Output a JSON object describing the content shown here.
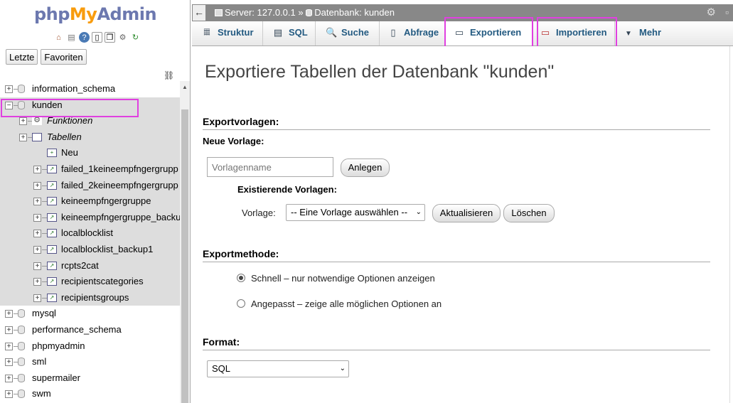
{
  "app": {
    "logo": {
      "php": "php",
      "my": "My",
      "admin": "Admin"
    },
    "nav_buttons": {
      "recent": "Letzte",
      "favorites": "Favoriten"
    },
    "tree": [
      {
        "label": "information_schema",
        "type": "db",
        "expanded": false
      },
      {
        "label": "kunden",
        "type": "db",
        "expanded": true,
        "selected": true
      },
      {
        "label": "Funktionen",
        "type": "group",
        "italic": true
      },
      {
        "label": "Tabellen",
        "type": "group",
        "italic": true
      },
      {
        "label": "Neu",
        "type": "new"
      },
      {
        "label": "failed_1keineempfngergrupp",
        "type": "table"
      },
      {
        "label": "failed_2keineempfngergrupp",
        "type": "table"
      },
      {
        "label": "keineempfngergruppe",
        "type": "table"
      },
      {
        "label": "keineempfngergruppe_backu",
        "type": "table"
      },
      {
        "label": "localblocklist",
        "type": "table"
      },
      {
        "label": "localblocklist_backup1",
        "type": "table"
      },
      {
        "label": "rcpts2cat",
        "type": "table"
      },
      {
        "label": "recipientscategories",
        "type": "table"
      },
      {
        "label": "recipientsgroups",
        "type": "table"
      },
      {
        "label": "mysql",
        "type": "db",
        "expanded": false
      },
      {
        "label": "performance_schema",
        "type": "db",
        "expanded": false
      },
      {
        "label": "phpmyadmin",
        "type": "db",
        "expanded": false
      },
      {
        "label": "sml",
        "type": "db",
        "expanded": false
      },
      {
        "label": "supermailer",
        "type": "db",
        "expanded": false
      },
      {
        "label": "swm",
        "type": "db",
        "expanded": false
      }
    ]
  },
  "header": {
    "server": "Server: 127.0.0.1",
    "separator": "»",
    "database": "Datenbank: kunden"
  },
  "tabs": [
    {
      "label": "Struktur",
      "icon": "structure-icon"
    },
    {
      "label": "SQL",
      "icon": "sql-icon"
    },
    {
      "label": "Suche",
      "icon": "search-icon"
    },
    {
      "label": "Abfrage",
      "icon": "query-icon"
    },
    {
      "label": "Exportieren",
      "icon": "export-icon",
      "active": true
    },
    {
      "label": "Importieren",
      "icon": "import-icon"
    },
    {
      "label": "Mehr",
      "icon": "caret-down-icon"
    }
  ],
  "main": {
    "title": "Exportiere Tabellen der Datenbank \"kunden\"",
    "templates": {
      "heading": "Exportvorlagen:",
      "new_label": "Neue Vorlage:",
      "name_placeholder": "Vorlagenname",
      "create_button": "Anlegen",
      "existing_label": "Existierende Vorlagen:",
      "template_label": "Vorlage:",
      "template_select": "-- Eine Vorlage auswählen --",
      "update_button": "Aktualisieren",
      "delete_button": "Löschen"
    },
    "method": {
      "heading": "Exportmethode:",
      "quick": "Schnell – nur notwendige Optionen anzeigen",
      "custom": "Angepasst – zeige alle möglichen Optionen an",
      "selected": "quick"
    },
    "format": {
      "heading": "Format:",
      "value": "SQL"
    }
  },
  "colors": {
    "highlight": "#e040e0",
    "tab_text": "#235a81",
    "logo_blue": "#6c78af",
    "logo_orange": "#f89c0e"
  }
}
